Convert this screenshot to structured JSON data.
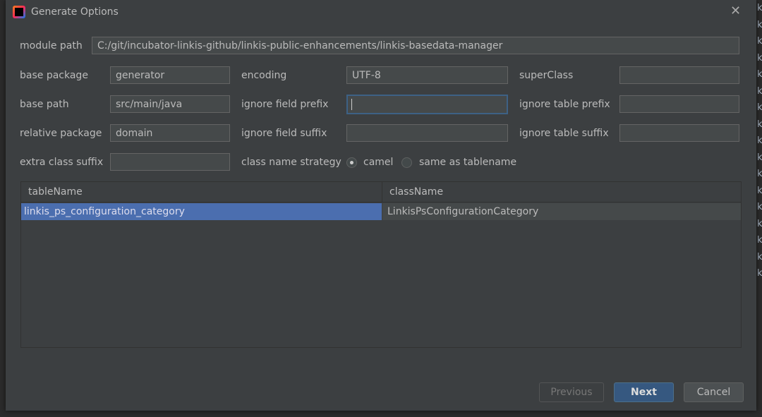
{
  "background_fragments": [
    "ki",
    "ki",
    "ki",
    "ki",
    "ki",
    "ki",
    "ki",
    "ki",
    "ki",
    "ki",
    "ki",
    "ki",
    "ki",
    "ki",
    "ki",
    "ki",
    "ki"
  ],
  "dialog": {
    "title": "Generate Options",
    "close_icon": "close-icon"
  },
  "form": {
    "module_path": {
      "label": "module path",
      "value": "C:/git/incubator-linkis-github/linkis-public-enhancements/linkis-basedata-manager"
    },
    "base_package": {
      "label": "base package",
      "value": "generator"
    },
    "encoding": {
      "label": "encoding",
      "value": "UTF-8"
    },
    "super_class": {
      "label": "superClass",
      "value": ""
    },
    "base_path": {
      "label": "base path",
      "value": "src/main/java"
    },
    "ignore_field_prefix": {
      "label": "ignore field prefix",
      "value": ""
    },
    "ignore_table_prefix": {
      "label": "ignore table prefix",
      "value": ""
    },
    "relative_package": {
      "label": "relative package",
      "value": "domain"
    },
    "ignore_field_suffix": {
      "label": "ignore field suffix",
      "value": ""
    },
    "ignore_table_suffix": {
      "label": "ignore table suffix",
      "value": ""
    },
    "extra_class_suffix": {
      "label": "extra class suffix",
      "value": ""
    },
    "class_name_strategy": {
      "label": "class name strategy",
      "options": [
        "camel",
        "same as tablename"
      ],
      "selected": "camel"
    }
  },
  "table": {
    "columns": [
      "tableName",
      "className"
    ],
    "rows": [
      {
        "tableName": "linkis_ps_configuration_category",
        "className": "LinkisPsConfigurationCategory",
        "selected": true
      }
    ]
  },
  "buttons": {
    "previous": "Previous",
    "next": "Next",
    "cancel": "Cancel"
  },
  "colors": {
    "accent": "#365880",
    "selection": "#4b6eaf",
    "dialog_bg": "#3c3f41"
  }
}
